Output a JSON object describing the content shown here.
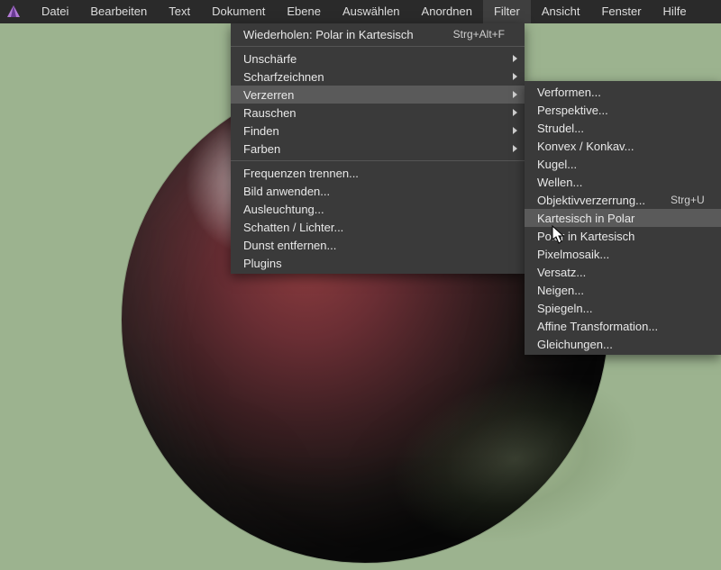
{
  "menubar": {
    "items": [
      {
        "label": "Datei"
      },
      {
        "label": "Bearbeiten"
      },
      {
        "label": "Text"
      },
      {
        "label": "Dokument"
      },
      {
        "label": "Ebene"
      },
      {
        "label": "Auswählen"
      },
      {
        "label": "Anordnen"
      },
      {
        "label": "Filter"
      },
      {
        "label": "Ansicht"
      },
      {
        "label": "Fenster"
      },
      {
        "label": "Hilfe"
      }
    ],
    "open_index": 7
  },
  "filter_menu": {
    "repeat_label": "Wiederholen: Polar in Kartesisch",
    "repeat_shortcut": "Strg+Alt+F",
    "groups": [
      {
        "label": "Unschärfe"
      },
      {
        "label": "Scharfzeichnen"
      },
      {
        "label": "Verzerren",
        "highlight": true
      },
      {
        "label": "Rauschen"
      },
      {
        "label": "Finden"
      },
      {
        "label": "Farben"
      }
    ],
    "actions": [
      {
        "label": "Frequenzen trennen..."
      },
      {
        "label": "Bild anwenden..."
      },
      {
        "label": "Ausleuchtung..."
      },
      {
        "label": "Schatten / Lichter..."
      },
      {
        "label": "Dunst entfernen..."
      },
      {
        "label": "Plugins"
      }
    ]
  },
  "verzerren_menu": {
    "items": [
      {
        "label": "Verformen..."
      },
      {
        "label": "Perspektive..."
      },
      {
        "label": "Strudel..."
      },
      {
        "label": "Konvex / Konkav..."
      },
      {
        "label": "Kugel..."
      },
      {
        "label": "Wellen..."
      },
      {
        "label": "Objektivverzerrung...",
        "shortcut": "Strg+U"
      },
      {
        "label": "Kartesisch in Polar",
        "highlight": true
      },
      {
        "label": "Polar in Kartesisch"
      },
      {
        "label": "Pixelmosaik..."
      },
      {
        "label": "Versatz..."
      },
      {
        "label": "Neigen..."
      },
      {
        "label": "Spiegeln..."
      },
      {
        "label": "Affine Transformation..."
      },
      {
        "label": "Gleichungen..."
      }
    ]
  }
}
